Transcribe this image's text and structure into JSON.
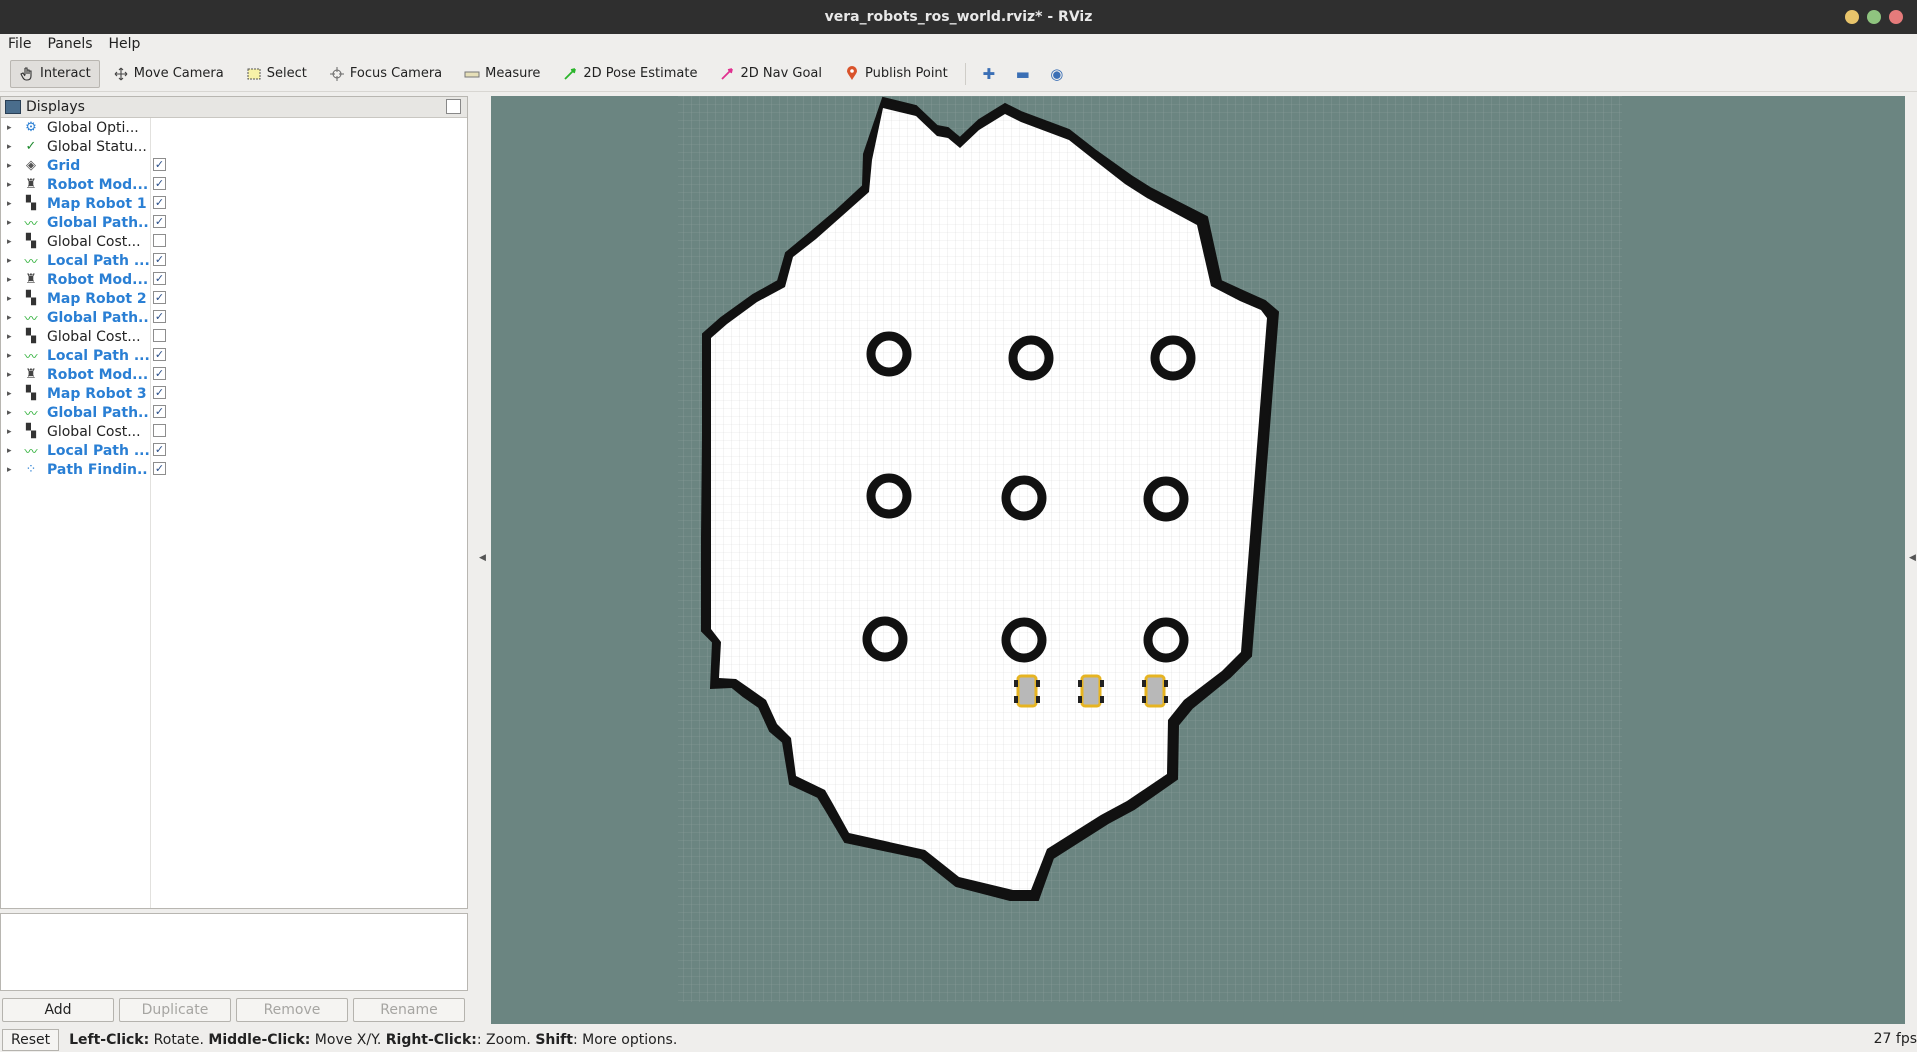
{
  "window": {
    "title": "vera_robots_ros_world.rviz* - RViz",
    "buttons": [
      {
        "name": "minimize",
        "color": "#e8c46b"
      },
      {
        "name": "maximize",
        "color": "#8fc47f"
      },
      {
        "name": "close",
        "color": "#e57b7b"
      }
    ]
  },
  "menu": {
    "file": "File",
    "panels": "Panels",
    "help": "Help"
  },
  "toolbar": {
    "interact": "Interact",
    "move_camera": "Move Camera",
    "select": "Select",
    "focus_camera": "Focus Camera",
    "measure": "Measure",
    "pose_estimate": "2D Pose Estimate",
    "nav_goal": "2D Nav Goal",
    "publish_point": "Publish Point",
    "active_tool": "Interact"
  },
  "displays": {
    "title": "Displays",
    "items": [
      {
        "label": "Global Opti...",
        "icon": "gear-icon",
        "blue": false,
        "checkbox": "none"
      },
      {
        "label": "Global Statu...",
        "icon": "checkmark-icon",
        "blue": false,
        "checkbox": "none"
      },
      {
        "label": "Grid",
        "icon": "grid-icon",
        "blue": true,
        "checkbox": "checked"
      },
      {
        "label": "Robot Mod...",
        "icon": "robot-model-icon",
        "blue": true,
        "checkbox": "checked"
      },
      {
        "label": "Map Robot 1",
        "icon": "map-icon",
        "blue": true,
        "checkbox": "checked"
      },
      {
        "label": "Global Path...",
        "icon": "path-icon",
        "blue": true,
        "checkbox": "checked"
      },
      {
        "label": "Global Cost...",
        "icon": "map-icon",
        "blue": false,
        "checkbox": "unchecked"
      },
      {
        "label": "Local Path ...",
        "icon": "path-icon",
        "blue": true,
        "checkbox": "checked"
      },
      {
        "label": "Robot Mod...",
        "icon": "robot-model-icon",
        "blue": true,
        "checkbox": "checked"
      },
      {
        "label": "Map Robot 2",
        "icon": "map-icon",
        "blue": true,
        "checkbox": "checked"
      },
      {
        "label": "Global Path...",
        "icon": "path-icon",
        "blue": true,
        "checkbox": "checked"
      },
      {
        "label": "Global Cost...",
        "icon": "map-icon",
        "blue": false,
        "checkbox": "unchecked"
      },
      {
        "label": "Local Path ...",
        "icon": "path-icon",
        "blue": true,
        "checkbox": "checked"
      },
      {
        "label": "Robot Mod...",
        "icon": "robot-model-icon",
        "blue": true,
        "checkbox": "checked"
      },
      {
        "label": "Map Robot 3",
        "icon": "map-icon",
        "blue": true,
        "checkbox": "checked"
      },
      {
        "label": "Global Path...",
        "icon": "path-icon",
        "blue": true,
        "checkbox": "checked"
      },
      {
        "label": "Global Cost...",
        "icon": "map-icon",
        "blue": false,
        "checkbox": "unchecked"
      },
      {
        "label": "Local Path ...",
        "icon": "path-icon",
        "blue": true,
        "checkbox": "checked"
      },
      {
        "label": "Path Findin...",
        "icon": "markers-icon",
        "blue": true,
        "checkbox": "checked"
      }
    ]
  },
  "panel_buttons": {
    "add": "Add",
    "duplicate": "Duplicate",
    "remove": "Remove",
    "rename": "Rename"
  },
  "status": {
    "reset": "Reset",
    "left_click": "Left-Click:",
    "left_action": " Rotate. ",
    "middle_click": "Middle-Click:",
    "middle_action": " Move X/Y. ",
    "right_click": "Right-Click:",
    "right_action": ": Zoom. ",
    "shift": "Shift",
    "shift_action": ": More options.",
    "fps": "27 fps"
  },
  "viewport": {
    "background_color": "#6b8581",
    "free_space_color": "#ffffff",
    "obstacle_color": "#111111",
    "grid_color": "#8fa09c",
    "robot_color": "#e6b422",
    "obstacle_count": 9,
    "robot_count": 3
  }
}
